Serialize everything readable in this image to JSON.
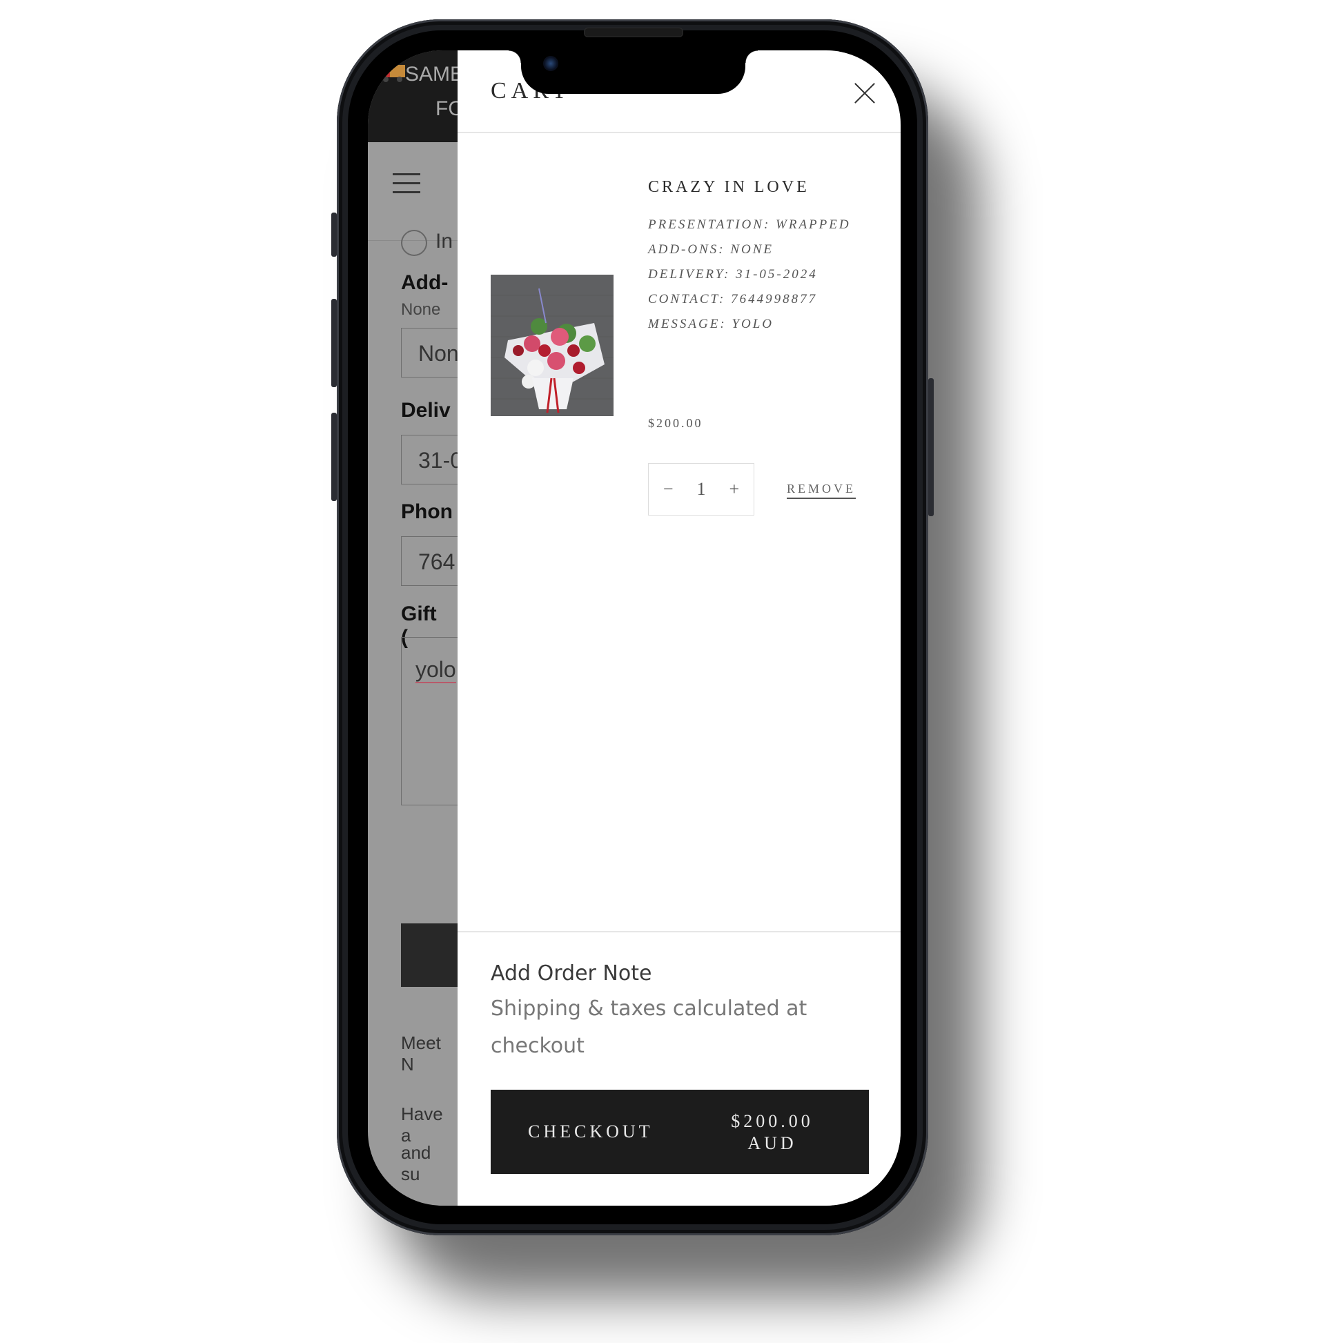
{
  "background_page": {
    "banner_line1": "SAME",
    "banner_line2": "FO",
    "banner_icon": "delivery-truck-icon",
    "radio_label": "In",
    "addons_label": "Add-",
    "addons_sub": "None",
    "addons_value": "Non",
    "delivery_label": "Deliv",
    "delivery_value": "31-0",
    "phone_label": "Phon",
    "phone_value": "764",
    "gift_label": "Gift (",
    "gift_value": "yolo",
    "footer_text1": "Meet N",
    "footer_text2": "Have a",
    "footer_text3": "and su"
  },
  "cart": {
    "title": "CART",
    "close_icon": "close-icon",
    "item": {
      "name": "CRAZY IN LOVE",
      "properties": [
        "PRESENTATION: WRAPPED",
        "ADD-ONS: NONE",
        "DELIVERY: 31-05-2024",
        "CONTACT: 7644998877",
        "MESSAGE: YOLO"
      ],
      "price": "$200.00",
      "quantity": "1",
      "decrement_symbol": "−",
      "increment_symbol": "+",
      "remove_label": "REMOVE"
    },
    "order_note_label": "Add Order Note",
    "shipping_note": "Shipping & taxes calculated at checkout",
    "checkout_label": "CHECKOUT",
    "checkout_amount": "$200.00 AUD"
  },
  "colors": {
    "checkout_bg": "#1c1c1c",
    "overlay_page": "#9a9a9a",
    "banner_bg": "#1b1b1b"
  }
}
